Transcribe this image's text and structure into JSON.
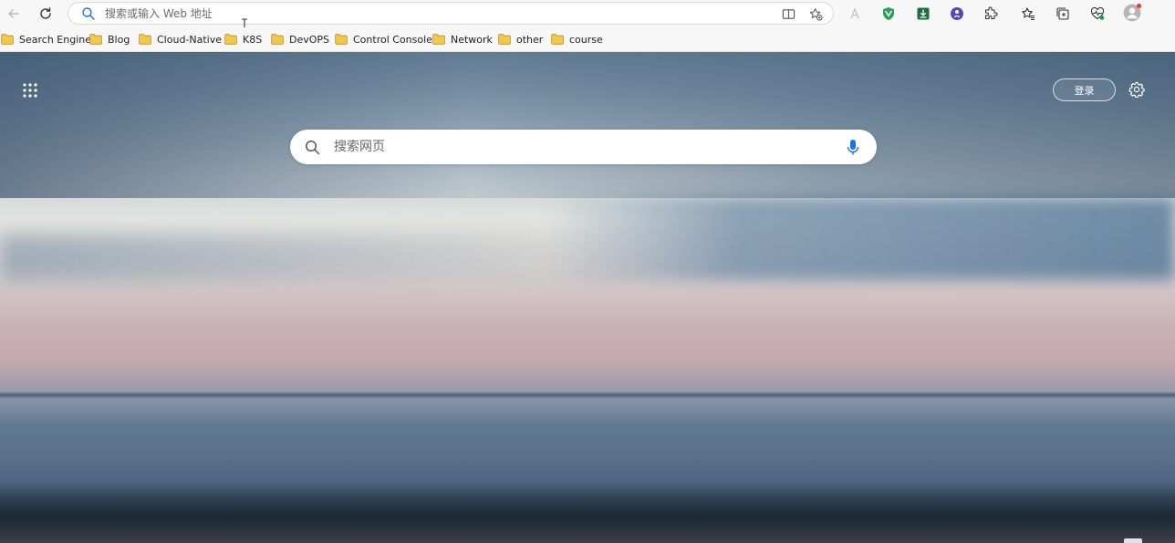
{
  "toolbar": {
    "address_placeholder": "搜索或输入 Web 地址"
  },
  "bookmarks": [
    {
      "label": "Search Engine"
    },
    {
      "label": "Blog"
    },
    {
      "label": "Cloud-Native"
    },
    {
      "label": "K8S"
    },
    {
      "label": "DevOPS"
    },
    {
      "label": "Control Console"
    },
    {
      "label": "Network"
    },
    {
      "label": "other"
    },
    {
      "label": "course"
    }
  ],
  "page": {
    "login_label": "登录",
    "search_placeholder": "搜索网页"
  },
  "colors": {
    "accent_blue": "#1a73e8",
    "folder_yellow": "#f2c94c",
    "toolbar_bg": "#f7f7f7"
  },
  "icons": [
    "back-arrow-icon",
    "reload-icon",
    "search-icon",
    "reader-view-icon",
    "add-favorite-icon",
    "read-aloud-icon",
    "shield-extension-icon",
    "download-extension-icon",
    "circle-extension-icon",
    "extensions-puzzle-icon",
    "favorites-icon",
    "collections-icon",
    "performance-heart-icon",
    "profile-avatar-icon",
    "apps-grid-icon",
    "settings-gear-icon",
    "microphone-icon",
    "folder-icon"
  ]
}
